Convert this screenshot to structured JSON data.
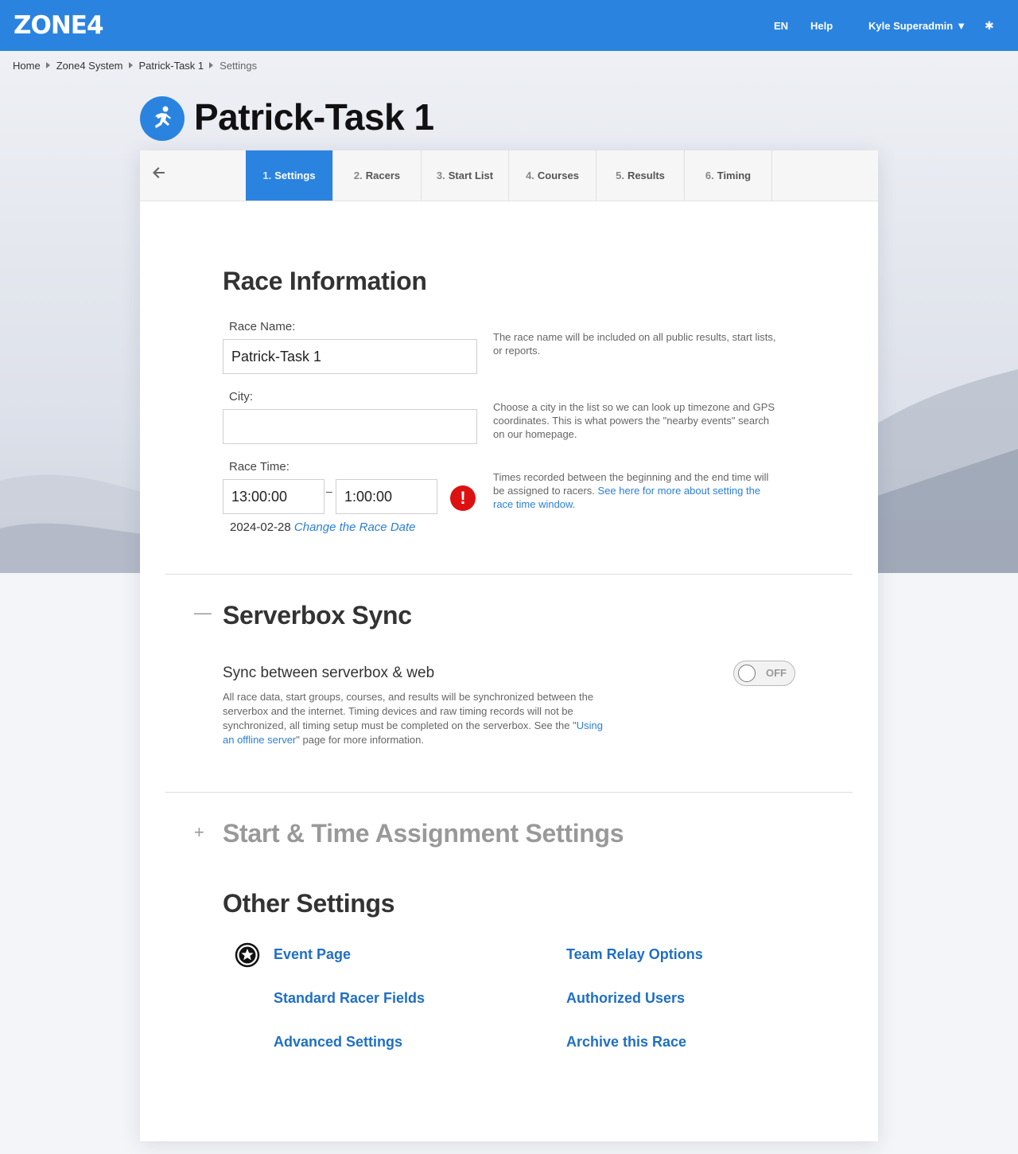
{
  "header": {
    "logo": "ZONE4",
    "lang": "EN",
    "help": "Help",
    "user": "Kyle Superadmin",
    "user_caret": "▼",
    "settings_glyph": "✱"
  },
  "breadcrumb": [
    "Home",
    "Zone4 System",
    "Patrick-Task 1",
    "Settings"
  ],
  "page": {
    "title": "Patrick-Task 1",
    "icon": "running-person-icon"
  },
  "tabs": [
    {
      "num": "1.",
      "label": "Settings"
    },
    {
      "num": "2.",
      "label": "Racers"
    },
    {
      "num": "3.",
      "label": "Start List"
    },
    {
      "num": "4.",
      "label": "Courses"
    },
    {
      "num": "5.",
      "label": "Results"
    },
    {
      "num": "6.",
      "label": "Timing"
    }
  ],
  "race_info": {
    "title": "Race Information",
    "race_name_label": "Race Name:",
    "race_name_value": "Patrick-Task 1",
    "race_name_help": "The race name will be included on all public results, start lists, or reports.",
    "city_label": "City:",
    "city_value": "",
    "city_help": "Choose a city in the list so we can look up timezone and GPS coordinates. This is what powers the \"nearby events\" search on our homepage.",
    "race_time_label": "Race Time:",
    "start_time": "13:00:00",
    "time_separator": "–",
    "end_time": "1:00:00",
    "error_glyph": "!",
    "race_date": "2024-02-28",
    "change_date_link": "Change the Race Date",
    "time_help": "Times recorded between the beginning and the end time will be assigned to racers.",
    "time_help_link": "See here for more about setting the race time window."
  },
  "serverbox": {
    "title": "Serverbox Sync",
    "collapse_glyph": "—",
    "sync_title": "Sync between serverbox & web",
    "desc_before": "All race data, start groups, courses, and results will be synchronized between the serverbox and the internet. Timing devices and raw timing records will not be synchronized, all timing setup must be completed on the serverbox. See the \"",
    "desc_link": "Using an offline server",
    "desc_after": "\" page for more information.",
    "toggle_label": "OFF",
    "toggle_on": false
  },
  "start_time": {
    "title": "Start & Time Assignment Settings",
    "expand_glyph": "+"
  },
  "other": {
    "title": "Other Settings",
    "links": {
      "event_page": "Event Page",
      "team_relay": "Team Relay Options",
      "standard_fields": "Standard Racer Fields",
      "authorized_users": "Authorized Users",
      "advanced": "Advanced Settings",
      "archive": "Archive this Race"
    }
  },
  "colors": {
    "brand": "#2b83e0",
    "link": "#1f6fc4",
    "error": "#dd1111"
  }
}
